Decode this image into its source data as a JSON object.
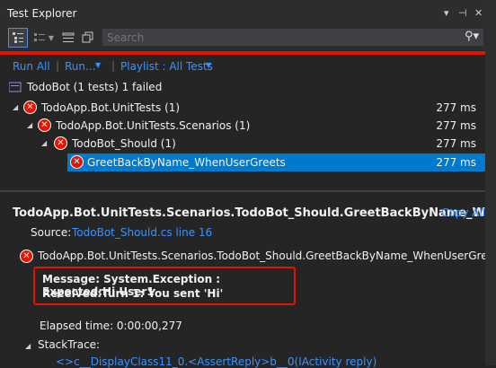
{
  "window": {
    "title": "Test Explorer",
    "controls": {
      "dropdown": "▾",
      "pin": "⊣",
      "close": "✕"
    }
  },
  "toolbar": {
    "search_placeholder": "Search",
    "search_icon": "search-icon"
  },
  "actions": {
    "run_all": "Run All",
    "run": "Run...",
    "playlist": "Playlist : All Tests"
  },
  "summary": "TodoBot (1 tests) 1 failed",
  "tree": [
    {
      "label": "TodoApp.Bot.UnitTests (1)",
      "duration": "277 ms"
    },
    {
      "label": "TodoApp.Bot.UnitTests.Scenarios (1)",
      "duration": "277 ms"
    },
    {
      "label": "TodoBot_Should (1)",
      "duration": "277 ms"
    },
    {
      "label": "GreetBackByName_WhenUserGreets",
      "duration": "277 ms"
    }
  ],
  "detail": {
    "title": "TodoApp.Bot.UnitTests.Scenarios.TodoBot_Should.GreetBackByName_Wh...",
    "copy_all": "Copy All",
    "source_label": "Source:",
    "source_link": "TodoBot_Should.cs line 16",
    "test_name": "TodoApp.Bot.UnitTests.Scenarios.TodoBot_Should.GreetBackByName_WhenUserGreets",
    "message_line1": "Message: System.Exception : Expected:Hi User1",
    "message_line2": "Received:Turn 1: You sent 'Hi'",
    "elapsed": "Elapsed time: 0:00:00,277",
    "stacktrace_label": "StackTrace:",
    "stacktrace_line": "<>c__DisplayClass11_0.<AssertReply>b__0(IActivity reply)"
  },
  "colors": {
    "accent": "#007acc",
    "error": "#e51400",
    "link": "#3794ff"
  }
}
